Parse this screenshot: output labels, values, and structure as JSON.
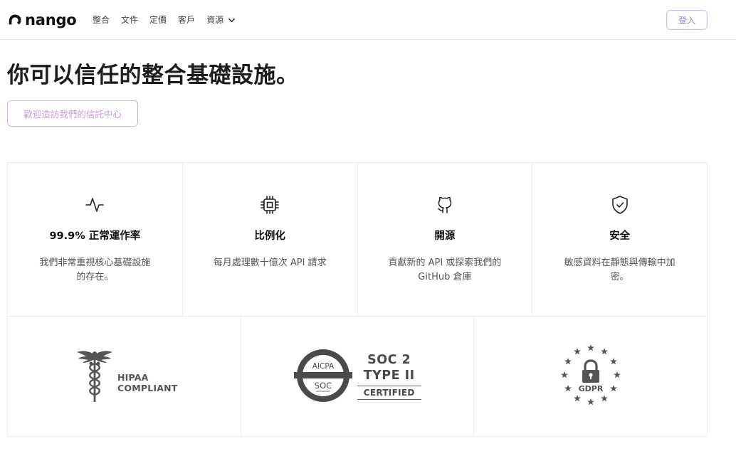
{
  "header": {
    "logo_text": "nango",
    "nav": [
      {
        "label": "整合"
      },
      {
        "label": "文件"
      },
      {
        "label": "定價"
      },
      {
        "label": "客戶"
      },
      {
        "label": "資源"
      }
    ],
    "login_label": "登入"
  },
  "hero": {
    "title": "你可以信任的整合基礎設施。",
    "trust_button": "歡迎造訪我們的信託中心"
  },
  "features": [
    {
      "icon": "pulse-icon",
      "title": "99.9% 正常運作率",
      "desc": "我們非常重視核心基礎設施的存在。"
    },
    {
      "icon": "cpu-icon",
      "title": "比例化",
      "desc": "每月處理數十億次 API 請求"
    },
    {
      "icon": "github-icon",
      "title": "開源",
      "desc": "貢獻新的 API 或探索我們的 GitHub 倉庫"
    },
    {
      "icon": "shield-check-icon",
      "title": "安全",
      "desc": "敏感資料在靜態與傳輸中加密。"
    }
  ],
  "compliance": {
    "hipaa": {
      "line1": "HIPAA",
      "line2": "COMPLIANT"
    },
    "soc": {
      "ring_top": "AICPA",
      "ring_center": "SOC",
      "line1": "SOC 2",
      "line2": "TYPE II",
      "line3": "CERTIFIED"
    },
    "gdpr": {
      "label": "GDPR"
    }
  },
  "colors": {
    "login_border": "#cfc4ee",
    "trust_text": "#c79ee0",
    "badge_gray": "#4a4a4a"
  }
}
